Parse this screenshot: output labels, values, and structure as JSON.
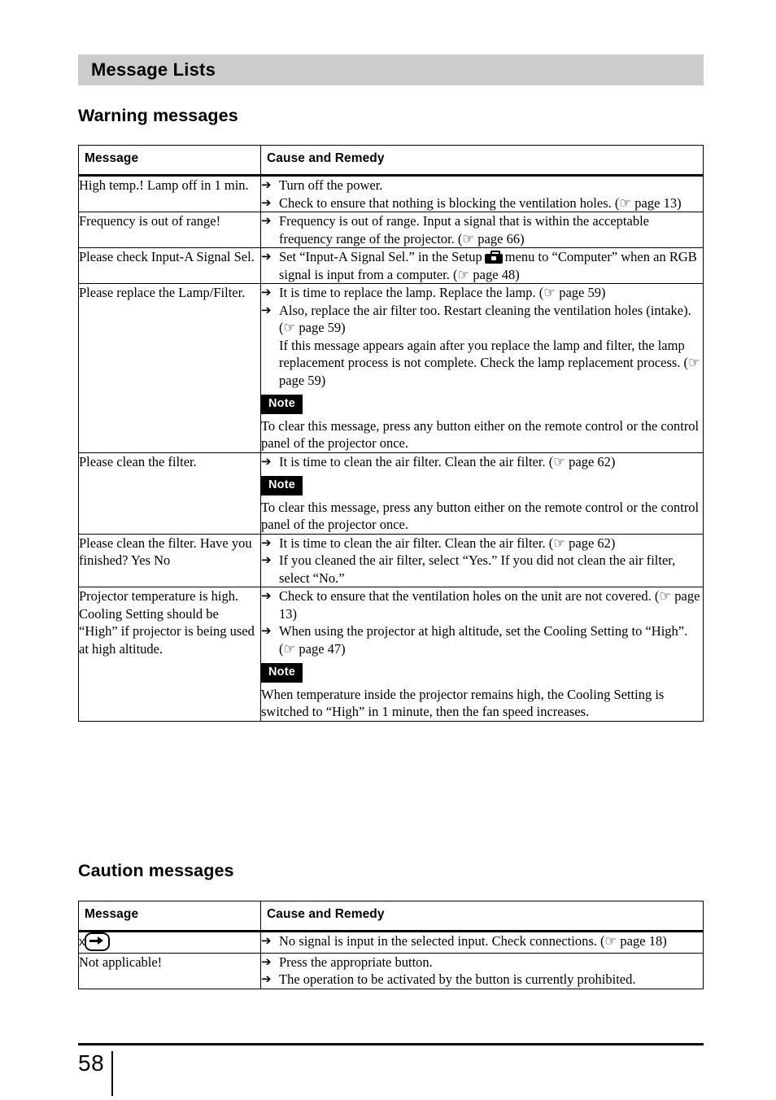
{
  "section": {
    "band_title": "Message Lists"
  },
  "headings": {
    "warning": "Warning messages",
    "caution": "Caution messages"
  },
  "table_headers": {
    "message": "Message",
    "cause": "Cause and Remedy"
  },
  "icons": {
    "arrow_bullet": "➔",
    "pointing_hand": "☞",
    "toolbox": "setup-toolbox-icon",
    "x_input": "x-no-input-icon"
  },
  "warning_rows": [
    {
      "message": "High temp.! Lamp off in 1 min.",
      "bullets": [
        "Turn off the power.",
        "Check to ensure that nothing is blocking the ventilation holes. (☞ page 13)"
      ]
    },
    {
      "message": "Frequency is out of range!",
      "bullets": [
        "Frequency is out of range. Input a signal that is within the acceptable frequency range of the projector. (☞ page 66)"
      ]
    },
    {
      "message": "Please check Input-A Signal Sel.",
      "bullets_split": {
        "part1": "Set “Input-A Signal Sel.” in the Setup",
        "part2": "menu to “Computer” when an RGB signal is input from a computer. (☞ page 48)"
      }
    },
    {
      "message": "Please replace the Lamp/Filter.",
      "bullets": [
        "It is time to replace the lamp. Replace the lamp. (☞ page 59)",
        "Also, replace the air filter too. Restart cleaning the ventilation holes (intake). (☞ page 59)"
      ],
      "continuation": "If this message appears again after you replace the lamp and filter, the lamp replacement process is not complete. Check the lamp replacement process. (☞ page 59)",
      "note_label": "Note",
      "note_text": "To clear this message, press any button either on the remote control or the control panel of the projector once."
    },
    {
      "message": "Please clean the filter.",
      "bullets": [
        "It is time to clean the air filter. Clean the air filter. (☞ page 62)"
      ],
      "note_label": "Note",
      "note_text": "To clear this message, press any button either on the remote control or the control panel of the projector once."
    },
    {
      "message": "Please clean the filter. Have you finished? Yes No",
      "bullets": [
        "It is time to clean the air filter. Clean the air filter. (☞ page 62)",
        "If you cleaned the air filter, select “Yes.” If you did not clean the air filter, select “No.”"
      ]
    },
    {
      "message": "Projector temperature is high.  Cooling Setting should be “High”  if projector is being used at high altitude.",
      "bullets": [
        "Check to ensure that the ventilation holes on the unit are not covered. (☞ page 13)",
        "When using the projector at high altitude, set the Cooling Setting to “High”. (☞ page 47)"
      ],
      "note_label": "Note",
      "note_text": "When temperature inside the projector remains high, the Cooling Setting is switched to “High” in 1 minute, then the fan speed increases."
    }
  ],
  "caution_rows": [
    {
      "message_is_icon": true,
      "message_icon_x": "x",
      "bullets": [
        "No signal is input in the selected input. Check connections. (☞ page 18)"
      ]
    },
    {
      "message": "Not applicable!",
      "bullets": [
        "Press the appropriate button.",
        "The operation to be activated by the button is currently prohibited."
      ]
    }
  ],
  "footer": {
    "page_number": "58"
  }
}
